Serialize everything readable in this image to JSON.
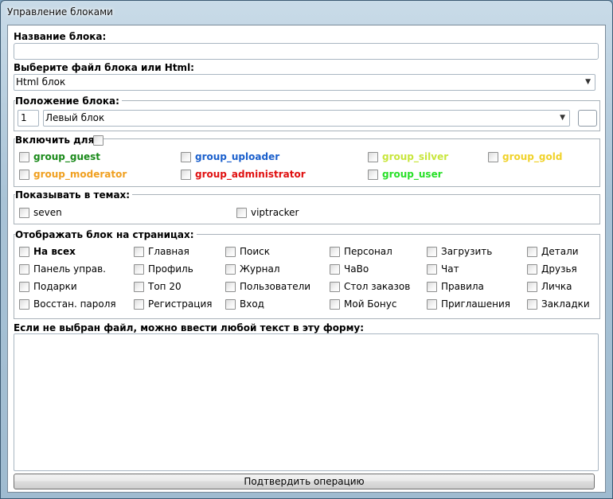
{
  "window": {
    "title": "Управление блоками"
  },
  "form": {
    "name_label": "Название блока:",
    "name_value": "",
    "file_label": "Выберите файл блока или Html:",
    "file_selected": "Html блок",
    "position": {
      "label": "Положение блока:",
      "order_value": "1",
      "side_selected": "Левый блок"
    },
    "enable": {
      "label": "Включить для:",
      "groups": [
        {
          "label": "group_guest",
          "color": "#1a8a1a"
        },
        {
          "label": "group_uploader",
          "color": "#1a5fcc"
        },
        {
          "label": "group_silver",
          "color": "#c8e63c"
        },
        {
          "label": "group_gold",
          "color": "#f0d22a"
        },
        {
          "label": "group_moderator",
          "color": "#f0a020"
        },
        {
          "label": "group_administrator",
          "color": "#e01010"
        },
        {
          "label": "group_user",
          "color": "#28e028"
        }
      ]
    },
    "themes": {
      "label": "Показывать в темах:",
      "items": [
        "seven",
        "viptracker"
      ]
    },
    "pages": {
      "label": "Отображать блок на страницах:",
      "items": [
        "На всех",
        "Главная",
        "Поиск",
        "Персонал",
        "Загрузить",
        "Детали",
        "Панель управ.",
        "Профиль",
        "Журнал",
        "ЧаВо",
        "Чат",
        "Друзья",
        "Подарки",
        "Топ 20",
        "Пользователи",
        "Стол заказов",
        "Правила",
        "Личка",
        "Восстан. пароля",
        "Регистрация",
        "Вход",
        "Мой Бонус",
        "Приглашения",
        "Закладки"
      ]
    },
    "text_label": "Если не выбран файл, можно ввести любой текст в эту форму:",
    "text_value": "",
    "submit_label": "Подтвердить операцию"
  }
}
